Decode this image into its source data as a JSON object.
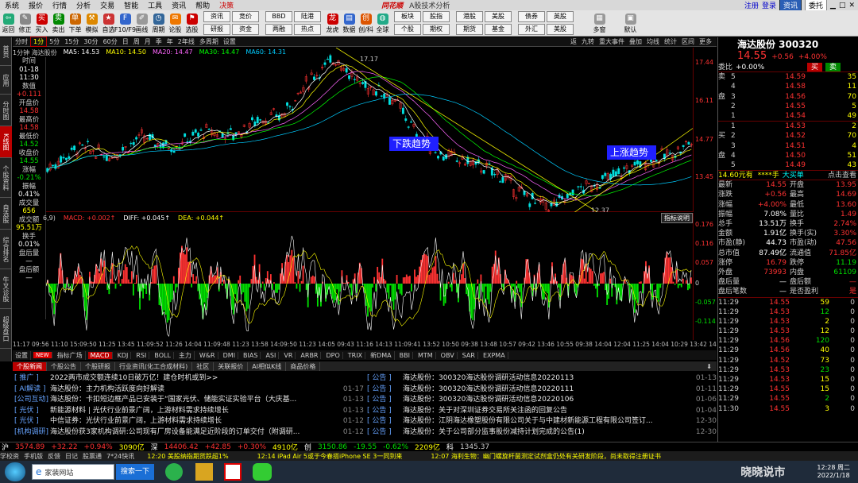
{
  "menu": {
    "items": [
      "系统",
      "报价",
      "行情",
      "分析",
      "交易",
      "智能",
      "工具",
      "资讯",
      "帮助",
      "决策"
    ],
    "brand": "同花顺",
    "subtitle": "A股技术分析",
    "login": "注册",
    "login2": "登录",
    "tab1": "资讯",
    "tab2": "委托"
  },
  "toolbar": {
    "buttons": [
      "返回",
      "修正",
      "买入",
      "卖出",
      "下单",
      "模拟",
      "自选",
      "F10/F9",
      "画线",
      "周期",
      "论股",
      "选股"
    ],
    "grid1": [
      "资讯",
      "竞价",
      "研报",
      "资金"
    ],
    "grid2": [
      "BBD",
      "陆港",
      "两融",
      "热点"
    ],
    "mid": [
      "龙虎",
      "数据",
      "创/科",
      "全球"
    ],
    "grid3": [
      "板块",
      "股指",
      "个股",
      "期权"
    ],
    "grid4": [
      "港股",
      "美股",
      "期货",
      "基金"
    ],
    "grid5": [
      "债券",
      "英股",
      "外汇",
      "美股"
    ],
    "tail": [
      "多窗",
      "默认"
    ]
  },
  "leftnav": [
    "首页",
    "应用",
    "分时图",
    "K线图",
    "个股资料",
    "自选股",
    "综合排名",
    "牛叉诊股",
    "超级盘口"
  ],
  "period": {
    "items": [
      "分时",
      "1分",
      "5分",
      "15分",
      "30分",
      "60分",
      "日",
      "周",
      "月",
      "季",
      "年",
      "2年线",
      "多周期",
      "设置"
    ],
    "selected": "1分",
    "right": [
      "返",
      "九转",
      "重大事件",
      "叠加",
      "均线",
      "统计",
      "区间",
      "更多"
    ]
  },
  "ma": {
    "label": "1分钟 海达股份",
    "ma5": "MA5: 14.53",
    "ma10": "MA10: 14.50",
    "ma20": "MA20: 14.47",
    "ma30": "MA30: 14.47",
    "ma60": "MA60: 14.31"
  },
  "info": [
    {
      "k": "时间",
      "v": "01-18"
    },
    {
      "k": "",
      "v": "11:30"
    },
    {
      "k": "数值",
      "v": "+0.111"
    },
    {
      "k": "开盘价",
      "v": "14.58"
    },
    {
      "k": "最高价",
      "v": "14.58"
    },
    {
      "k": "最低价",
      "v": "14.52"
    },
    {
      "k": "收盘价",
      "v": "14.55"
    },
    {
      "k": "涨幅",
      "v": "-0.21%"
    },
    {
      "k": "振幅",
      "v": "0.41%"
    },
    {
      "k": "成交量",
      "v": "656"
    },
    {
      "k": "成交额",
      "v": "95.51万"
    },
    {
      "k": "换手",
      "v": "0.01%"
    },
    {
      "k": "盘后量",
      "v": "—"
    },
    {
      "k": "盘后额",
      "v": "—"
    }
  ],
  "chart": {
    "high_label": "17.17",
    "low_label": "12.37",
    "down_trend": "下跌趋势",
    "up_trend": "上涨趋势",
    "y1": [
      "17.44",
      "16.11",
      "14.77",
      "13.45"
    ],
    "y2": [
      "0.176",
      "0.116",
      "0.057",
      "0",
      "-0.057",
      "-0.114"
    ]
  },
  "macd": {
    "prefix": "6,9)",
    "macd": "MACD: +0.002↑",
    "diff": "DIFF: +0.045↑",
    "dea": "DEA: +0.044↑",
    "help": "指标说明"
  },
  "timeaxis": "11:17 09:56 11:10 15:09:50 11:25 13:45 11:09:52 11:26 14:04 11:09:48 11:23 13:58 14:09:50 11:23 14:05 09:43 11:16 14:13 11:09:41 13:52 10:50 09:38 13:48 10:57 09:42 13:46 10:55 09:38 14:04 12:04 11:25 14:04 10:29 13:42 14:10 14:36 14:39 15:03 10:47 14:51",
  "indicators": {
    "items": [
      "设置",
      "NEW",
      "指标广场",
      "MACD",
      "KDJ",
      "RSI",
      "BOLL",
      "主力",
      "W&R",
      "DMI",
      "BIAS",
      "ASI",
      "VR",
      "ARBR",
      "DPO",
      "TRIX",
      "新DMA",
      "BBI",
      "MTM",
      "OBV",
      "SAR",
      "EXPMA"
    ],
    "selected": "MACD"
  },
  "newstabs": {
    "items": [
      "个股新闻",
      "个股公告",
      "个股研报",
      "行业资讯(化工合成材料)",
      "社区",
      "关联报价",
      "AI相似K线",
      "商品价格"
    ],
    "selected": "个股新闻"
  },
  "news_left": [
    {
      "tag": "[ 推广 ]",
      "title": "2022两市成交额连续10日破万亿！建仓时机或到>>",
      "date": ""
    },
    {
      "tag": "[ AI解读 ]",
      "title": "海达股份：主力机构活跃度向好解读",
      "date": "01-17"
    },
    {
      "tag": "[公司互动]",
      "title": "海达股份：卡扣短边框产品已安装于“国家光伏、储能实证实验平台（大庆基...",
      "date": "01-13"
    },
    {
      "tag": "[ 光伏 ]",
      "title": "新能源材料 | 光伏行业前景广阔，上游材料需求持续增长",
      "date": "01-13"
    },
    {
      "tag": "[ 光伏 ]",
      "title": "中信证券：光伏行业前景广阔，上游材料需求持续增长",
      "date": "01-12"
    },
    {
      "tag": "[机构调研]",
      "title": "海达股份获3家机构调研:公司现有厂房设备能满足近阶段的订单交付（附调研...",
      "date": "01-12"
    }
  ],
  "news_right": [
    {
      "tag": "[ 公告 ]",
      "title": "海达股份：300320海达股份调研活动信息20220113",
      "date": "01-13"
    },
    {
      "tag": "[ 公告 ]",
      "title": "海达股份：300320海达股份调研活动信息20220111",
      "date": "01-11"
    },
    {
      "tag": "[ 公告 ]",
      "title": "海达股份：300320海达股份调研活动信息20220106",
      "date": "01-06"
    },
    {
      "tag": "[ 公告 ]",
      "title": "海达股份：关于对深圳证券交易所关注函的回复公告",
      "date": "01-04"
    },
    {
      "tag": "[ 公告 ]",
      "title": "海达股份：江阴海达橡塑股份有限公司关于与中建材新能源工程有限公司签订...",
      "date": "12-30"
    },
    {
      "tag": "[ 公告 ]",
      "title": "海达股份：关于公司部分监事股份减持计划完成的公告(1)",
      "date": "12-30"
    }
  ],
  "indexbar": [
    "沪",
    "3574.89",
    "+32.22",
    "+0.94%",
    "3090亿",
    "深",
    "14406.42",
    "+42.85",
    "+0.30%",
    "4910亿",
    "创",
    "3150.86",
    "-19.55",
    "-0.62%",
    "2209亿",
    "科",
    "1345.37"
  ],
  "ticker": [
    "学校资",
    "手机版",
    "反馈",
    "日记",
    "股票通",
    "7*24快讯",
    "12:20 美股纳指期货跌超1%",
    "12:14 iPad Air 5或于今春搭iPhone SE 3一同到来",
    "12:07 海利生物：幽门螺旋杆菌测定试剂盒仍处有关研发阶段，尚未取得注册证书"
  ],
  "taskbar": {
    "ie_text": "家装网站",
    "search": "搜索一下",
    "time": "12:28 周二",
    "date": "2022/1/18",
    "watermark": "晓晓说市"
  },
  "quote": {
    "name": "海达股份 300320",
    "price": "14.55",
    "chg": "+0.56",
    "pct": "+4.00%",
    "weibi_k": "委比",
    "weibi": "+0.00%",
    "buy": "买",
    "sell": "卖",
    "asks": [
      {
        "n": "5",
        "p": "14.59",
        "v": "35"
      },
      {
        "n": "4",
        "p": "14.58",
        "v": "11"
      },
      {
        "n": "3",
        "p": "14.56",
        "v": "70"
      },
      {
        "n": "2",
        "p": "14.55",
        "v": "5"
      },
      {
        "n": "1",
        "p": "14.54",
        "v": "49"
      }
    ],
    "bids": [
      {
        "n": "1",
        "p": "14.53",
        "v": "2"
      },
      {
        "n": "2",
        "p": "14.52",
        "v": "70"
      },
      {
        "n": "3",
        "p": "14.51",
        "v": "4"
      },
      {
        "n": "4",
        "p": "14.50",
        "v": "51"
      },
      {
        "n": "5",
        "p": "14.49",
        "v": "43"
      }
    ],
    "big": "14.60元有",
    "bigv": "****手",
    "bigk": "大买单",
    "bigr": "点击查看",
    "stats": [
      [
        "最新",
        "14.55",
        "开盘",
        "13.95"
      ],
      [
        "涨跌",
        "+0.56",
        "最高",
        "14.69"
      ],
      [
        "涨幅",
        "+4.00%",
        "最低",
        "13.60"
      ],
      [
        "振幅",
        "7.08%",
        "量比",
        "1.49"
      ],
      [
        "总手",
        "13.51万",
        "换手",
        "2.74%"
      ],
      [
        "金额",
        "1.91亿",
        "换手(实)",
        "3.30%"
      ],
      [
        "市盈(静)",
        "44.73",
        "市盈(动)",
        "47.56"
      ],
      [
        "总市值",
        "87.49亿",
        "流通值",
        "71.85亿"
      ],
      [
        "涨停",
        "16.79",
        "跌停",
        "11.19"
      ],
      [
        "外盘",
        "73993",
        "内盘",
        "61109"
      ],
      [
        "盘后量",
        "—",
        "盘后额",
        "—"
      ],
      [
        "盘后笔数",
        "—",
        "是否盈利",
        "是"
      ]
    ],
    "ticks": [
      [
        "11:29",
        "14.55",
        "59",
        "0"
      ],
      [
        "11:29",
        "14.53",
        "12",
        "0"
      ],
      [
        "11:29",
        "14.53",
        "2",
        "0"
      ],
      [
        "11:29",
        "14.53",
        "12",
        "0"
      ],
      [
        "11:29",
        "14.56",
        "120",
        "0"
      ],
      [
        "11:29",
        "14.56",
        "40",
        "0"
      ],
      [
        "11:29",
        "14.52",
        "73",
        "0"
      ],
      [
        "11:29",
        "14.53",
        "23",
        "0"
      ],
      [
        "11:29",
        "14.53",
        "15",
        "0"
      ],
      [
        "11:29",
        "14.55",
        "15",
        "0"
      ],
      [
        "11:29",
        "14.55",
        "2",
        "0"
      ],
      [
        "11:30",
        "14.55",
        "3",
        "0"
      ]
    ]
  },
  "colors": {
    "red": "#ff3232",
    "green": "#00e000",
    "yellow": "#ffff00",
    "ma5": "#ffffff",
    "ma10": "#ffff00",
    "ma20": "#ff66ff",
    "ma30": "#00ff00",
    "ma60": "#00ccff"
  }
}
